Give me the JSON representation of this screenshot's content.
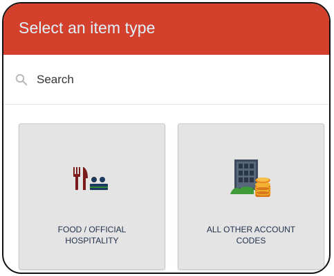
{
  "header": {
    "title": "Select an item type",
    "background_color": "#d3402c",
    "title_color": "#dff2fb"
  },
  "search": {
    "placeholder": "Search",
    "value": "",
    "icon": "search-icon"
  },
  "tiles": [
    {
      "icon": "food-hospitality-icon",
      "line1": "FOOD / OFFICIAL",
      "line2": "HOSPITALITY"
    },
    {
      "icon": "building-coins-icon",
      "line1": "ALL OTHER ACCOUNT",
      "line2": "CODES"
    }
  ]
}
